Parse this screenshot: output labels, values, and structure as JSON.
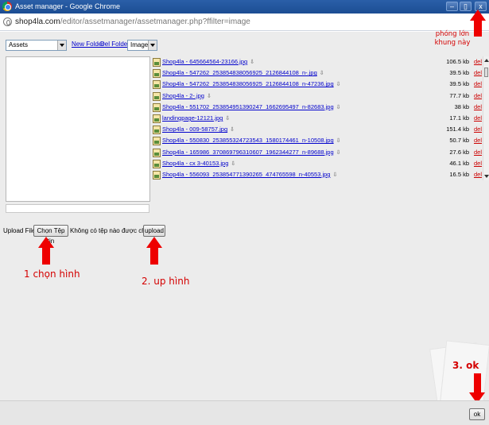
{
  "window": {
    "title": "Asset manager - Google Chrome",
    "minimize_label": "–",
    "maximize_label": "▯",
    "close_label": "x"
  },
  "address": {
    "domain": "shop4la.com",
    "path": "/editor/assetmanager/assetmanager.php?ffilter=image"
  },
  "toolbar": {
    "folder_select": "Assets",
    "new_folder": "New Folder",
    "del_folder": "Del Folder",
    "filter_select": "Images"
  },
  "files": [
    {
      "name": "Shop4la - 645664564-23166.jpg",
      "size": "106.5 kb",
      "del": "del"
    },
    {
      "name": "Shop4la - 547262_253854838056925_2126844108_n-.jpg",
      "size": "39.5 kb",
      "del": "del"
    },
    {
      "name": "Shop4la - 547262_253854838056925_2126844108_n-47236.jpg",
      "size": "39.5 kb",
      "del": "del"
    },
    {
      "name": "Shop4la - 2-.jpg",
      "size": "77.7 kb",
      "del": "del"
    },
    {
      "name": "Shop4la - 551702_253854951390247_1662695497_n-82683.jpg",
      "size": "38 kb",
      "del": "del"
    },
    {
      "name": "landingpage-12121.jpg",
      "size": "17.1 kb",
      "del": "del"
    },
    {
      "name": "Shop4la - 009-58757.jpg",
      "size": "151.4 kb",
      "del": "del"
    },
    {
      "name": "Shop4la - 550830_253855324723543_1580174461_n-10508.jpg",
      "size": "50.7 kb",
      "del": "del"
    },
    {
      "name": "Shop4la - 165986_370869796310607_1962344277_n-89688.jpg",
      "size": "27.6 kb",
      "del": "del"
    },
    {
      "name": "Shop4la - cx 3-40153.jpg",
      "size": "46.1 kb",
      "del": "del"
    },
    {
      "name": "Shop4la - 556093_253854771390265_474765598_n-40553.jpg",
      "size": "16.5 kb",
      "del": "del"
    }
  ],
  "upload": {
    "label": "Upload File:",
    "choose_button": "Chọn Tệp tin",
    "no_file_text": "Không có tệp nào được chọn",
    "upload_button": "upload"
  },
  "ok_button": "ok",
  "annotations": {
    "maximize_note_line1": "phóng lớn",
    "maximize_note_line2": "khung này",
    "step1": "1 chọn hình",
    "step2": "2. up hình",
    "step3": "3. ok",
    "color": "#d40000"
  }
}
